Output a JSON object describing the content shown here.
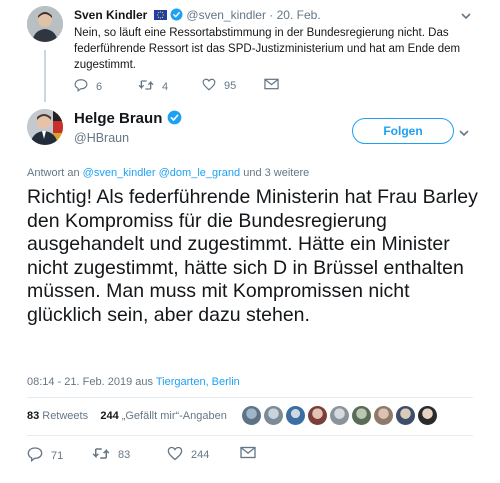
{
  "parent_tweet": {
    "name": "Sven Kindler",
    "handle": "@sven_kindler",
    "date": "· 20. Feb.",
    "text": "Nein, so läuft eine Ressortabstimmung in der Bundesregierung nicht. Das federführende Ressort ist das SPD-Justizministerium und hat am Ende dem zugestimmt.",
    "replies": "6",
    "retweets": "4",
    "likes": "95"
  },
  "main_tweet": {
    "name": "Helge Braun",
    "handle": "@HBraun",
    "follow_label": "Folgen",
    "reply_prefix": "Antwort an",
    "reply_handles": "@sven_kindler @dom_le_grand",
    "reply_suffix": "und 3 weitere",
    "text": "Richtig! Als federführende Ministerin hat Frau Barley den Kompromiss für die Bundesregierung ausgehandelt und zugestimmt. Hätte ein Minister nicht zugestimmt, hätte sich D in Brüssel enthalten müssen. Man muss mit Kompromissen nicht glücklich sein, aber dazu stehen.",
    "timestamp": "08:14 - 21. Feb. 2019 aus",
    "location": "Tiergarten, Berlin",
    "retweet_count": "83",
    "retweet_label": "Retweets",
    "like_count": "244",
    "like_label": "„Gefällt mir“-Angaben",
    "replies": "71",
    "retweets": "83",
    "likes": "244"
  },
  "colors": {
    "accent": "#1da1f2",
    "muted": "#657786",
    "verified": "#1da1f2"
  }
}
